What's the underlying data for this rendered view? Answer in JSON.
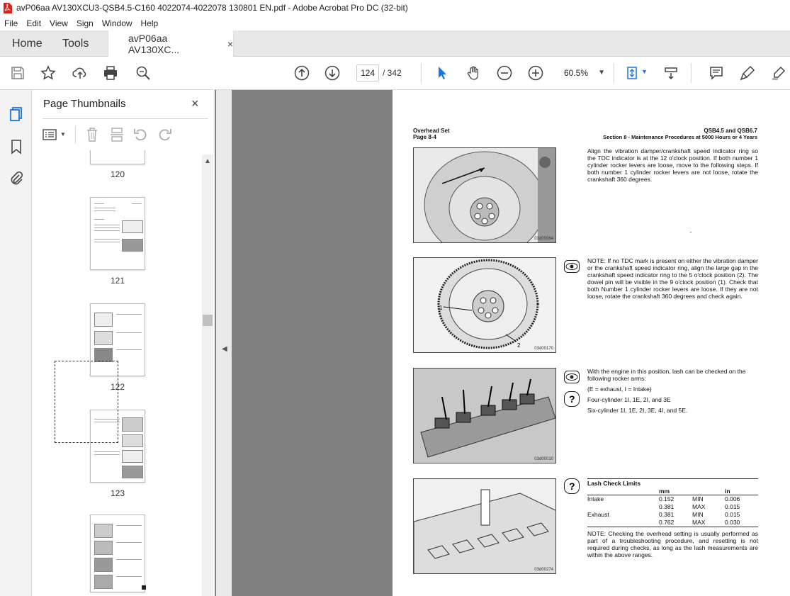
{
  "window": {
    "title": "avP06aa AV130XCU3-QSB4.5-C160 4022074-4022078 130801 EN.pdf - Adobe Acrobat Pro DC (32-bit)"
  },
  "menu": [
    "File",
    "Edit",
    "View",
    "Sign",
    "Window",
    "Help"
  ],
  "tabs": {
    "home": "Home",
    "tools": "Tools",
    "doc": "avP06aa AV130XC...",
    "close": "×"
  },
  "toolbar": {
    "page_current": "124",
    "page_total": "/ 342",
    "zoom": "60.5%"
  },
  "panel": {
    "title": "Page Thumbnails",
    "close": "×"
  },
  "thumbnails": [
    {
      "label": "120"
    },
    {
      "label": "121"
    },
    {
      "label": "122"
    },
    {
      "label": "123"
    }
  ],
  "colors": {
    "accent": "#1a73e8",
    "viewer_bg": "#808080",
    "pdf_red": "#d9211c"
  },
  "doc": {
    "header_left_1": "Overhead Set",
    "header_left_2": "Page 8-4",
    "header_right_1": "QSB4.5 and QSB6.7",
    "header_right_2": "Section 8 - Maintenance Procedures at 5000 Hours or 4 Years",
    "p1": "Align the vibration damper/crankshaft speed indicator ring so the TDC indicator is at the 12 o'clock position. If both number 1 cylinder rocker levers are loose, move to the following steps. If both number 1 cylinder rocker levers are not loose, rotate the crankshaft 360 degrees.",
    "note1": "NOTE: If no TDC mark is present on either the vibration damper or the crankshaft speed indicator ring, align the large gap in the crankshaft speed indicator ring to the 5 o'clock position (2). The dowel pin will be visible in the 9 o'clock position (1). Check that both Number 1 cylinder rocker levers are loose. If they are not loose, rotate the crankshaft 360 degrees and check again.",
    "p3a": "With the engine in this position, lash can be checked on the following rocker arms:",
    "p3b": "(E = exhaust, I = Intake)",
    "p3c": "Four-cylinder 1I, 1E, 2I, and 3E",
    "p3d": "Six-cylinder 1I, 1E, 2I, 3E, 4I, and 5E.",
    "lash_title": "Lash Check Limits",
    "lash_unit_mm": "mm",
    "lash_unit_in": "in",
    "lash_rows": [
      {
        "name": "Intake",
        "mm": "0.152",
        "lim": "MIN",
        "in": "0.006"
      },
      {
        "name": "",
        "mm": "0.381",
        "lim": "MAX",
        "in": "0.015"
      },
      {
        "name": "Exhaust",
        "mm": "0.381",
        "lim": "MIN",
        "in": "0.015"
      },
      {
        "name": "",
        "mm": "0.762",
        "lim": "MAX",
        "in": "0.030"
      }
    ],
    "note2": "NOTE: Checking the overhead setting is usually performed as part of a troubleshooting procedure, and resetting is not required during checks, as long as the lash measurements are within the above ranges.",
    "fig_ids": [
      "03d00064",
      "03d00170",
      "03d00010",
      "03d00274"
    ],
    "callout_1": "1",
    "callout_2": "2"
  }
}
